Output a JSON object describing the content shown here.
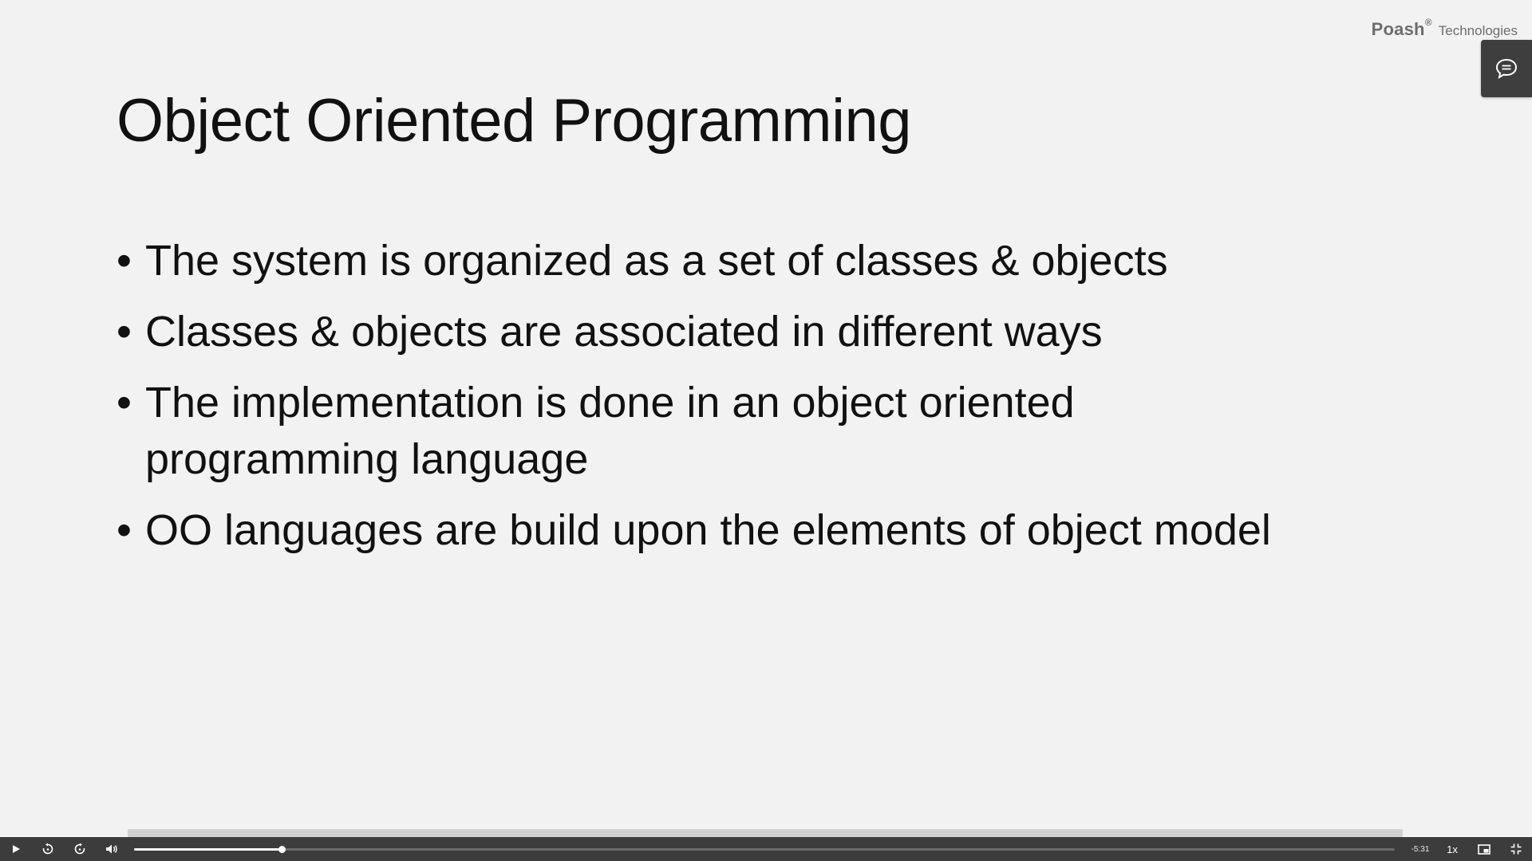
{
  "brand": {
    "name": "Poash",
    "mark": "®",
    "sub": "Technologies"
  },
  "slide": {
    "title": "Object Oriented Programming",
    "bullets": [
      "The system is organized as a set of classes & objects",
      "Classes & objects are associated in different ways",
      "The implementation is done in an object oriented programming language",
      "OO languages are build upon the elements of object model"
    ],
    "bullet_glyph": "•"
  },
  "player": {
    "time_remaining": "-5:31",
    "speed": "1x",
    "progress_fraction": 0.117
  },
  "icons": {
    "chat": "chat-bubble-icon",
    "play": "play-icon",
    "rewind": "rewind-10-icon",
    "forward": "forward-10-icon",
    "volume": "volume-icon",
    "pip": "picture-in-picture-icon",
    "exit_fullscreen": "exit-fullscreen-icon"
  },
  "colors": {
    "slide_bg": "#f2f2f2",
    "text": "#111111",
    "control_bar": "#3c3c3c",
    "brand_gray": "#6d6d6d"
  }
}
